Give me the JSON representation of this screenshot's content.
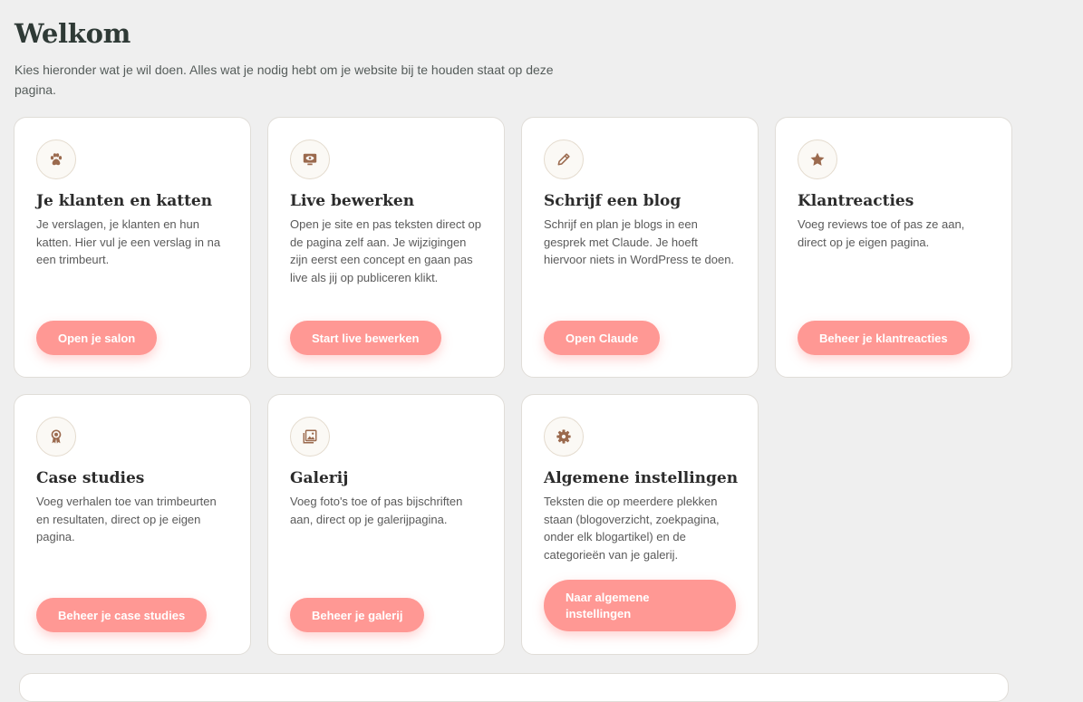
{
  "header": {
    "title": "Welkom",
    "intro": "Kies hieronder wat je wil doen. Alles wat je nodig hebt om je website bij te houden staat op deze pagina."
  },
  "colors": {
    "button": "#ff9894",
    "icon": "#9b6a4e",
    "background": "#efefef"
  },
  "cards": [
    {
      "icon": "paw-icon",
      "title": "Je klanten en katten",
      "text": "Je verslagen, je klanten en hun katten. Hier vul je een verslag in na een trimbeurt.",
      "button": "Open je salon"
    },
    {
      "icon": "monitor-eye-icon",
      "title": "Live bewerken",
      "text": "Open je site en pas teksten direct op de pagina zelf aan. Je wijzigingen zijn eerst een concept en gaan pas live als jij op publiceren klikt.",
      "button": "Start live bewerken"
    },
    {
      "icon": "pencil-icon",
      "title": "Schrijf een blog",
      "text": "Schrijf en plan je blogs in een gesprek met Claude. Je hoeft hiervoor niets in WordPress te doen.",
      "button": "Open Claude"
    },
    {
      "icon": "star-icon",
      "title": "Klantreacties",
      "text": "Voeg reviews toe of pas ze aan, direct op je eigen pagina.",
      "button": "Beheer je klantreacties"
    },
    {
      "icon": "award-icon",
      "title": "Case studies",
      "text": "Voeg verhalen toe van trimbeurten en resultaten, direct op je eigen pagina.",
      "button": "Beheer je case studies"
    },
    {
      "icon": "gallery-icon",
      "title": "Galerij",
      "text": "Voeg foto's toe of pas bijschriften aan, direct op je galerijpagina.",
      "button": "Beheer je galerij"
    },
    {
      "icon": "gear-icon",
      "title": "Algemene instellingen",
      "text": "Teksten die op meerdere plekken staan (blogoverzicht, zoekpagina, onder elk blogartikel) en de categorieën van je galerij.",
      "button": "Naar algemene instellingen"
    }
  ]
}
